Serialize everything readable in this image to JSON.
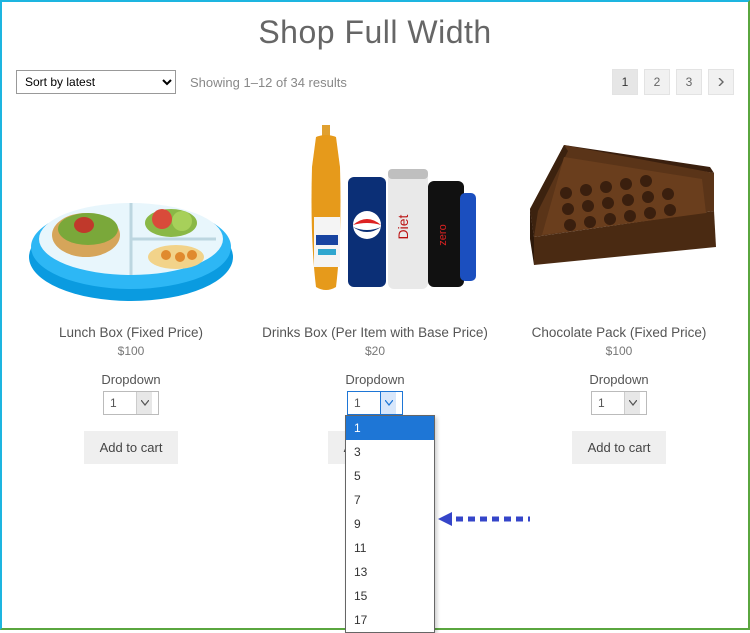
{
  "page": {
    "title": "Shop Full Width"
  },
  "sort": {
    "selected": "Sort by latest"
  },
  "result_count": "Showing 1–12 of 34 results",
  "pagination": {
    "current": "1",
    "p2": "2",
    "p3": "3"
  },
  "products": [
    {
      "title": "Lunch Box (Fixed Price)",
      "price": "$100",
      "dropdown_label": "Dropdown",
      "qty_value": "1",
      "add_label": "Add to cart"
    },
    {
      "title": "Drinks Box (Per Item with Base Price)",
      "price": "$20",
      "dropdown_label": "Dropdown",
      "qty_value": "1",
      "add_label": "Add to cart",
      "options": [
        "1",
        "3",
        "5",
        "7",
        "9",
        "11",
        "13",
        "15",
        "17"
      ]
    },
    {
      "title": "Chocolate Pack (Fixed Price)",
      "price": "$100",
      "dropdown_label": "Dropdown",
      "qty_value": "1",
      "add_label": "Add to cart"
    }
  ]
}
